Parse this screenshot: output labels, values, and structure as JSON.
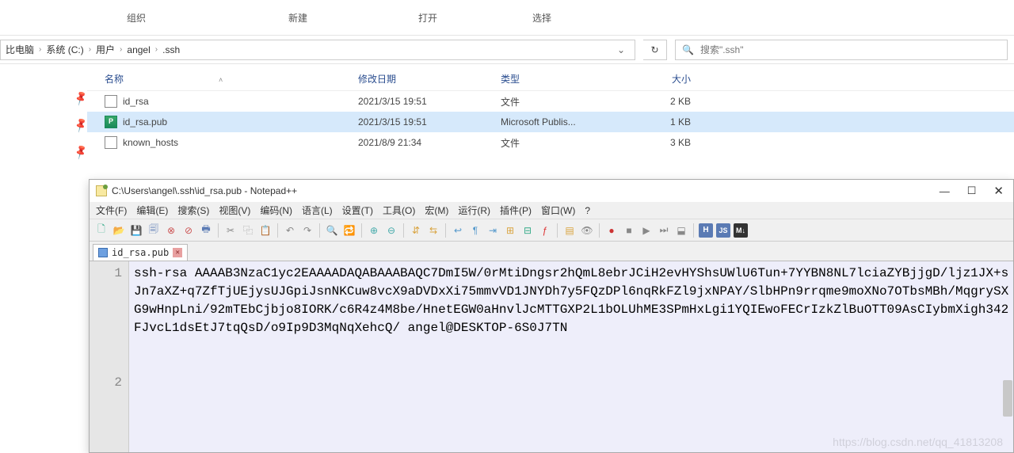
{
  "ribbon": {
    "group1": "组织",
    "group2": "新建",
    "group3": "打开",
    "group4": "选择"
  },
  "breadcrumb": {
    "segs": [
      "比电脑",
      "系统 (C:)",
      "用户",
      "angel",
      ".ssh"
    ]
  },
  "search": {
    "placeholder": "搜索\".ssh\""
  },
  "columns": {
    "name": "名称",
    "date": "修改日期",
    "type": "类型",
    "size": "大小"
  },
  "files": [
    {
      "name": "id_rsa",
      "date": "2021/3/15 19:51",
      "type": "文件",
      "size": "2 KB",
      "sel": false,
      "kind": "plain"
    },
    {
      "name": "id_rsa.pub",
      "date": "2021/3/15 19:51",
      "type": "Microsoft Publis...",
      "size": "1 KB",
      "sel": true,
      "kind": "pub"
    },
    {
      "name": "known_hosts",
      "date": "2021/8/9 21:34",
      "type": "文件",
      "size": "3 KB",
      "sel": false,
      "kind": "plain"
    }
  ],
  "npp": {
    "title": "C:\\Users\\angel\\.ssh\\id_rsa.pub - Notepad++",
    "menus": [
      "文件(F)",
      "编辑(E)",
      "搜索(S)",
      "视图(V)",
      "编码(N)",
      "语言(L)",
      "设置(T)",
      "工具(O)",
      "宏(M)",
      "运行(R)",
      "插件(P)",
      "窗口(W)",
      "?"
    ],
    "tab": "id_rsa.pub",
    "gutter": [
      "1",
      "2"
    ],
    "content": "ssh-rsa AAAAB3NzaC1yc2EAAAADAQABAAABAQC7DmI5W/0rMtiDngsr2hQmL8ebrJCiH2evHYShsUWlU6Tun+7YYBN8NL7lciaZYBjjgD/ljz1JX+sJn7aXZ+q7ZfTjUEjysUJGpiJsnNKCuw8vcX9aDVDxXi75mmvVD1JNYDh7y5FQzDPl6nqRkFZl9jxNPAY/SlbHPn9rrqme9moXNo7OTbsMBh/MqgrySXG9wHnpLni/92mTEbCjbjo8IORK/c6R4z4M8be/HnetEGW0aHnvlJcMTTGXP2L1bOLUhME3SPmHxLgi1YQIEwoFECrIzkZlBuOTT09AsCIybmXigh342FJvcL1dsEtJ7tqQsD/o9Ip9D3MqNqXehcQ/ angel@DESKTOP-6S0J7TN"
  },
  "watermark": "https://blog.csdn.net/qq_41813208"
}
